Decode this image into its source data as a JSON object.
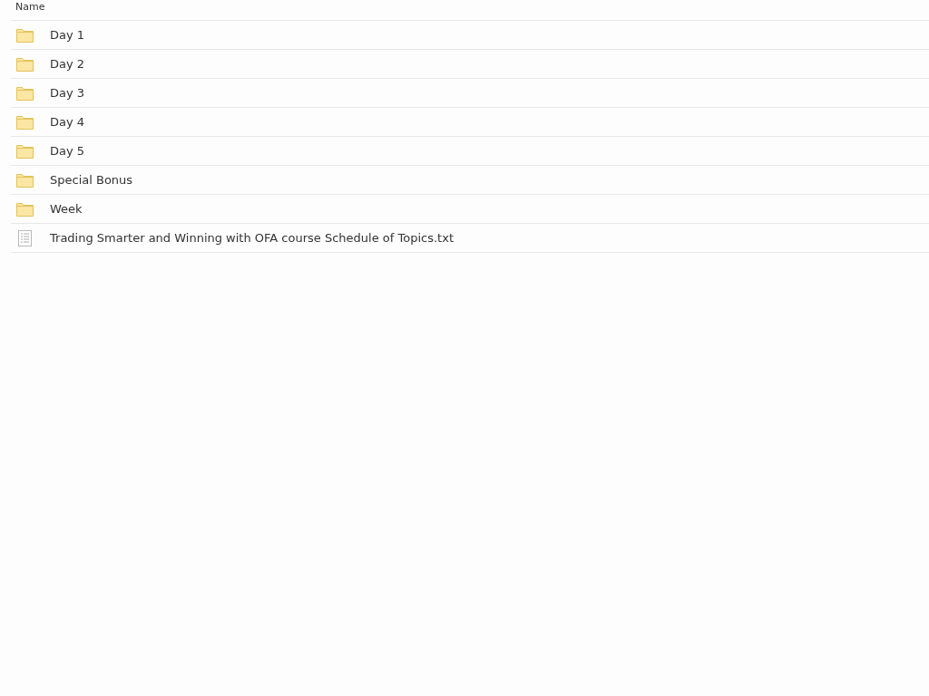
{
  "table": {
    "columns": [
      "Name"
    ],
    "rows": [
      {
        "kind": "folder",
        "name": "Day 1"
      },
      {
        "kind": "folder",
        "name": "Day 2"
      },
      {
        "kind": "folder",
        "name": "Day 3"
      },
      {
        "kind": "folder",
        "name": "Day 4"
      },
      {
        "kind": "folder",
        "name": "Day 5"
      },
      {
        "kind": "folder",
        "name": "Special Bonus"
      },
      {
        "kind": "folder",
        "name": "Week"
      },
      {
        "kind": "text_file",
        "name": "Trading Smarter and Winning with OFA course Schedule of Topics.txt"
      }
    ]
  }
}
